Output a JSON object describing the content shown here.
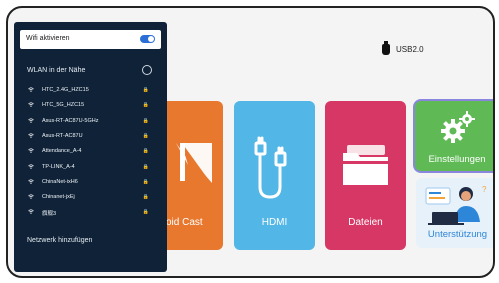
{
  "usb": {
    "label": "USB2.0"
  },
  "apps": {
    "cast": {
      "label": "oid Cast",
      "color": "#e8782e"
    },
    "hdmi": {
      "label": "HDMI",
      "color": "#52b6e6"
    },
    "files": {
      "label": "Dateien",
      "color": "#d63764"
    },
    "settings": {
      "label": "Einstellungen",
      "color": "#5fba56"
    },
    "support": {
      "label": "Unterstützung",
      "color": "#2e86d8"
    }
  },
  "wifi_panel": {
    "toggle_label": "Wifi aktivieren",
    "toggle_on": true,
    "nearby_title": "WLAN in der Nähe",
    "networks": [
      {
        "name": "HTC_2.4G_HZC15"
      },
      {
        "name": "HTC_5G_HZC15"
      },
      {
        "name": "Asus-RT-AC87U-5GHz"
      },
      {
        "name": "Asus-RT-AC87U"
      },
      {
        "name": "Attendance_A-4"
      },
      {
        "name": "TP-LINK_A-4"
      },
      {
        "name": "ChinaNet-ixH6"
      },
      {
        "name": "Chinanet-jxEj"
      },
      {
        "name": "旗舰3"
      }
    ],
    "add_network_label": "Netzwerk hinzufügen"
  }
}
